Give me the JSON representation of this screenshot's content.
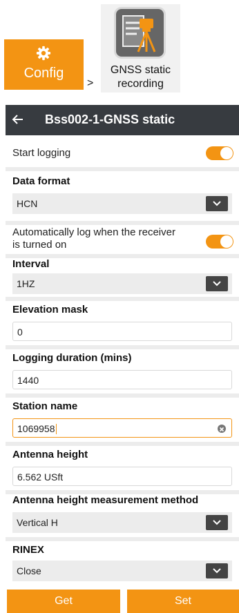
{
  "breadcrumb": {
    "config_label": "Config",
    "separator": ">",
    "app_label_line1": "GNSS static",
    "app_label_line2": "recording"
  },
  "header": {
    "title": "Bss002-1-GNSS static"
  },
  "form": {
    "start_logging": {
      "label": "Start logging",
      "on": true
    },
    "data_format": {
      "label": "Data format",
      "value": "HCN"
    },
    "auto_log": {
      "label_line1": "Automatically log when the receiver",
      "label_line2": "is turned on",
      "on": true
    },
    "interval": {
      "label": "Interval",
      "value": "1HZ"
    },
    "elevation_mask": {
      "label": "Elevation mask",
      "value": "0"
    },
    "logging_duration": {
      "label": "Logging duration (mins)",
      "value": "1440"
    },
    "station_name": {
      "label": "Station name",
      "value": "1069958"
    },
    "antenna_height": {
      "label": "Antenna height",
      "value": "6.562 USft"
    },
    "antenna_method": {
      "label": "Antenna height measurement method",
      "value": "Vertical H"
    },
    "rinex": {
      "label": "RINEX",
      "value": "Close"
    }
  },
  "actions": {
    "get_label": "Get",
    "set_label": "Set"
  },
  "colors": {
    "accent": "#f39413",
    "title_bar": "#373b40",
    "section_gap": "#ececec"
  },
  "icons": {
    "config": "gear-icon",
    "app": "gnss-static-recording-icon",
    "back": "back-arrow-icon",
    "dropdown": "chevron-down-icon",
    "clear": "clear-icon"
  }
}
